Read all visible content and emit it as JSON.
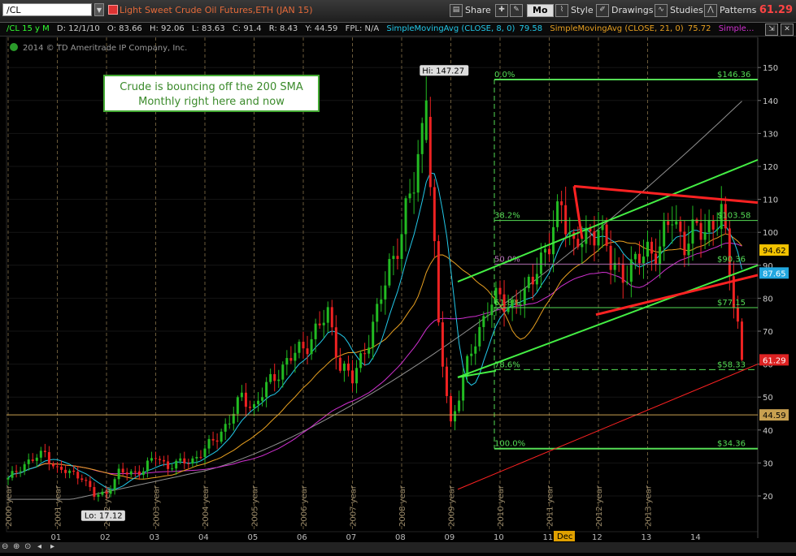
{
  "toolbar": {
    "symbol": "/CL",
    "description": "Light Sweet Crude Oil Futures,ETH (JAN 15)",
    "share_label": "Share",
    "mode_label": "Mo",
    "style_label": "Style",
    "drawings_label": "Drawings",
    "studies_label": "Studies",
    "patterns_label": "Patterns",
    "last_price": "61.29"
  },
  "infobar": {
    "symbol_period": "/CL 15 y M",
    "date": "D: 12/1/10",
    "open": "O: 83.66",
    "high": "H: 92.06",
    "low": "L: 83.63",
    "close": "C: 91.4",
    "range": "R: 8.43",
    "y": "Y: 44.59",
    "fpl": "FPL: N/A",
    "sma8_label": "SimpleMovingAvg (CLOSE, 8, 0)",
    "sma8_value": "79.58",
    "sma21_label": "SimpleMovingAvg (CLOSE, 21, 0)",
    "sma21_value": "75.72",
    "sma_more": "Simple..."
  },
  "copyright": "2014 © TD Ameritrade IP Company, Inc.",
  "annotation": {
    "line1": "Crude is bouncing off the 200 SMA",
    "line2": "Monthly right here and now"
  },
  "labels": {
    "hi": "Hi: 147.27",
    "lo": "Lo: 17.12",
    "cursor_month": "Dec"
  },
  "fib_labels": {
    "f0": "0.0%",
    "f382": "38.2%",
    "f50": "50.0%",
    "f618": "61.8%",
    "f786": "78.6%",
    "f100": "100.0%",
    "p0": "$146.36",
    "p382": "$103.58",
    "p50": "$90.36",
    "p618": "$77.15",
    "p786": "$58.33",
    "p100": "$34.36"
  },
  "price_tags": [
    {
      "value": "94.62",
      "price": 94.62,
      "bg": "#f2c200",
      "fg": "#000"
    },
    {
      "value": "87.65",
      "price": 87.65,
      "bg": "#22a8e0",
      "fg": "#fff"
    },
    {
      "value": "61.29",
      "price": 61.29,
      "bg": "#dd2222",
      "fg": "#fff"
    },
    {
      "value": "44.59",
      "price": 44.59,
      "bg": "#c8a050",
      "fg": "#000"
    }
  ],
  "colors": {
    "bull": "#22bb22",
    "bear": "#ee2222",
    "sma8": "#22c8e8",
    "sma21": "#e8a020",
    "sma50": "#d030d0",
    "sma200": "#909090",
    "fib": "#55dd55",
    "trend_red": "#ff2222",
    "channel_green": "#44ee44",
    "grid_year": "#6a5a3a"
  },
  "chart_data": {
    "type": "candlestick",
    "title": "/CL 15 y M",
    "yaxis": {
      "min": 15,
      "max": 155,
      "ticks": [
        20,
        30,
        40,
        50,
        60,
        70,
        80,
        90,
        100,
        110,
        120,
        130,
        140,
        150
      ]
    },
    "year_labels": [
      "2000 year",
      "2001 year",
      "2002 year",
      "2003 year",
      "2004 year",
      "2005 year",
      "2006 year",
      "2007 year",
      "2008 year",
      "2009 year",
      "2010 year",
      "2011 year",
      "2012 year",
      "2013 year"
    ],
    "month_ticks": [
      "01",
      "02",
      "03",
      "04",
      "05",
      "06",
      "07",
      "08",
      "09",
      "10",
      "11",
      "12",
      "13",
      "14"
    ],
    "approx_closes": [
      [
        2000.0,
        25
      ],
      [
        2000.25,
        29
      ],
      [
        2000.5,
        31
      ],
      [
        2000.75,
        33
      ],
      [
        2001.0,
        28
      ],
      [
        2001.25,
        27
      ],
      [
        2001.5,
        26
      ],
      [
        2001.75,
        20
      ],
      [
        2002.0,
        21
      ],
      [
        2002.25,
        27
      ],
      [
        2002.5,
        27
      ],
      [
        2002.75,
        28
      ],
      [
        2003.0,
        32
      ],
      [
        2003.25,
        29
      ],
      [
        2003.5,
        30
      ],
      [
        2003.75,
        31
      ],
      [
        2004.0,
        34
      ],
      [
        2004.25,
        38
      ],
      [
        2004.5,
        43
      ],
      [
        2004.75,
        50
      ],
      [
        2005.0,
        47
      ],
      [
        2005.25,
        53
      ],
      [
        2005.5,
        58
      ],
      [
        2005.75,
        62
      ],
      [
        2006.0,
        65
      ],
      [
        2006.25,
        70
      ],
      [
        2006.5,
        75
      ],
      [
        2006.75,
        60
      ],
      [
        2007.0,
        55
      ],
      [
        2007.25,
        65
      ],
      [
        2007.5,
        75
      ],
      [
        2007.75,
        90
      ],
      [
        2008.0,
        100
      ],
      [
        2008.25,
        115
      ],
      [
        2008.5,
        140
      ],
      [
        2008.75,
        70
      ],
      [
        2009.0,
        42
      ],
      [
        2009.25,
        55
      ],
      [
        2009.5,
        68
      ],
      [
        2009.75,
        77
      ],
      [
        2010.0,
        80
      ],
      [
        2010.25,
        78
      ],
      [
        2010.5,
        80
      ],
      [
        2010.75,
        91
      ],
      [
        2011.0,
        95
      ],
      [
        2011.25,
        110
      ],
      [
        2011.5,
        95
      ],
      [
        2011.75,
        98
      ],
      [
        2012.0,
        103
      ],
      [
        2012.25,
        90
      ],
      [
        2012.5,
        88
      ],
      [
        2012.75,
        90
      ],
      [
        2013.0,
        95
      ],
      [
        2013.25,
        95
      ],
      [
        2013.5,
        105
      ],
      [
        2013.75,
        97
      ],
      [
        2014.0,
        100
      ],
      [
        2014.25,
        102
      ],
      [
        2014.5,
        105
      ],
      [
        2014.6,
        95
      ],
      [
        2014.75,
        80
      ],
      [
        2014.9,
        66
      ],
      [
        2014.95,
        61.29
      ]
    ]
  }
}
